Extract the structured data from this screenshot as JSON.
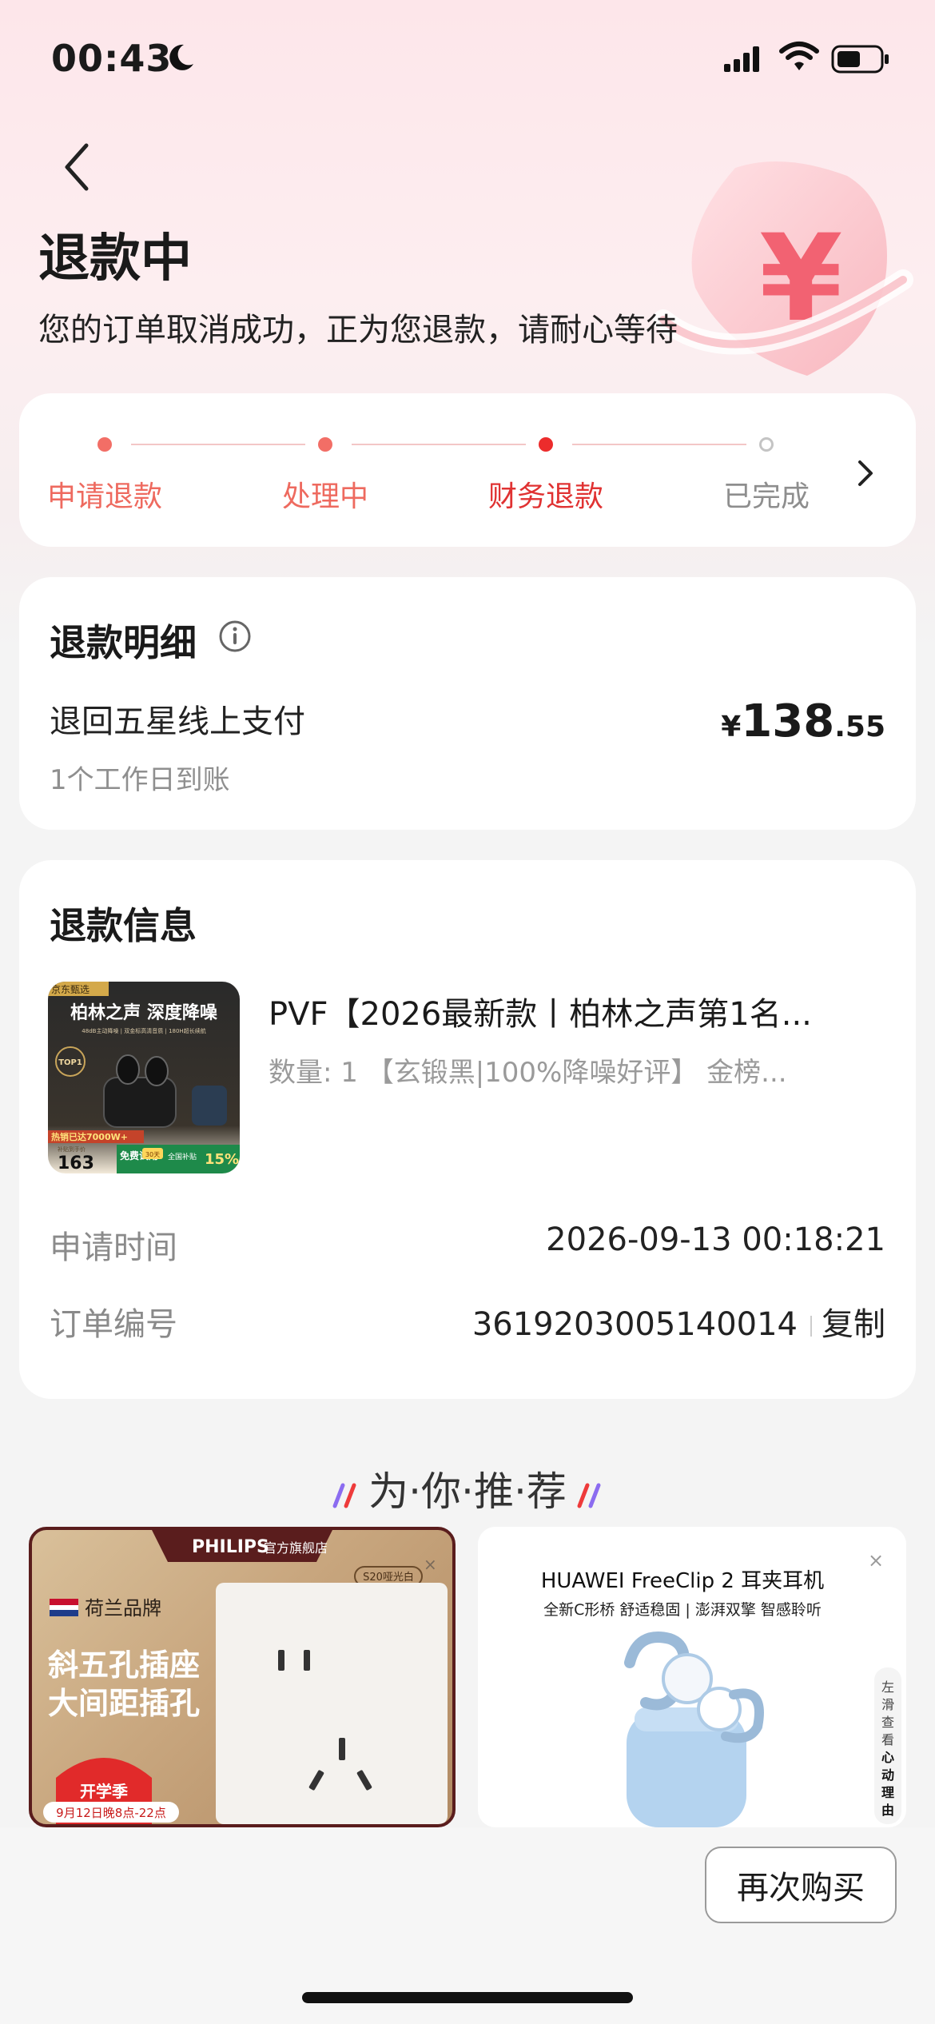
{
  "status_bar": {
    "time": "00:43"
  },
  "header": {
    "title": "退款中",
    "subtitle": "您的订单取消成功，正为您退款，请耐心等待"
  },
  "progress": {
    "steps": [
      {
        "label": "申请退款",
        "state": "done"
      },
      {
        "label": "处理中",
        "state": "done"
      },
      {
        "label": "财务退款",
        "state": "active"
      },
      {
        "label": "已完成",
        "state": "future"
      }
    ]
  },
  "refund_detail": {
    "title": "退款明细",
    "method": "退回五星线上支付",
    "eta": "1个工作日到账",
    "amount_currency": "¥",
    "amount_int": "138",
    "amount_dec": ".55"
  },
  "refund_info": {
    "title": "退款信息",
    "product": {
      "name": "PVF【2026最新款丨柏林之声第1名...",
      "spec": "数量: 1  【玄锻黑|100%降噪好评】 金榜...",
      "image": {
        "badge": "京东甄选",
        "headline": "柏林之声 深度降噪",
        "small_line": "48dB主动降噪 | 双金标高清音质 | 180H超长续航",
        "top_badge": "TOP1",
        "sold": "热销已达7000W+",
        "price_label": "补贴到手价",
        "price": "163",
        "trial": "免费试用",
        "trial_days": "30天",
        "subsidy": "全国补贴",
        "subsidy_pct": "15%"
      }
    },
    "apply_time_label": "申请时间",
    "apply_time": "2026-09-13 00:18:21",
    "order_no_label": "订单编号",
    "order_no": "3619203005140014",
    "copy_label": "复制"
  },
  "recommend": {
    "title": "为·你·推·荐",
    "ads": [
      {
        "brand": "PHILIPS",
        "store": "官方旗舰店",
        "tag": "S20哑光白",
        "origin": "荷兰品牌",
        "headline1": "斜五孔插座",
        "headline2": "大间距插孔",
        "promo": "开学季",
        "promo_date": "9月12日晚8点-22点"
      },
      {
        "title": "HUAWEI FreeClip 2 耳夹耳机",
        "sub": "全新C形桥 舒适稳固 | 澎湃双擎 智感聆听",
        "side_text": "左滑查看心动理由"
      }
    ]
  },
  "bottom": {
    "rebuy_label": "再次购买"
  },
  "colors": {
    "accent": "#ec2c2c",
    "step_done": "#f26e66",
    "bg": "#f4f4f4"
  }
}
